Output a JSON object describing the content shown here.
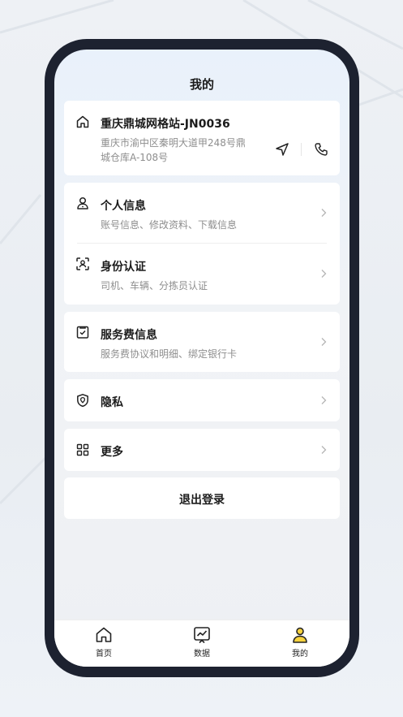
{
  "page": {
    "title": "我的"
  },
  "station": {
    "name": "重庆鼎城网格站-JN0036",
    "address_line1": "重庆市渝中区秦明大道甲248号鼎",
    "address_line2": "城仓库A-108号"
  },
  "menu": {
    "personal": {
      "title": "个人信息",
      "subtitle": "账号信息、修改资料、下载信息"
    },
    "identity": {
      "title": "身份认证",
      "subtitle": "司机、车辆、分拣员认证"
    },
    "service_fee": {
      "title": "服务费信息",
      "subtitle": "服务费协议和明细、绑定银行卡"
    },
    "privacy": {
      "title": "隐私"
    },
    "more": {
      "title": "更多"
    }
  },
  "logout": {
    "label": "退出登录"
  },
  "tabbar": {
    "items": [
      {
        "label": "首页"
      },
      {
        "label": "数据"
      },
      {
        "label": "我的",
        "active": true
      }
    ]
  },
  "colors": {
    "accent": "#f7d23e",
    "dark": "#1d2230"
  }
}
